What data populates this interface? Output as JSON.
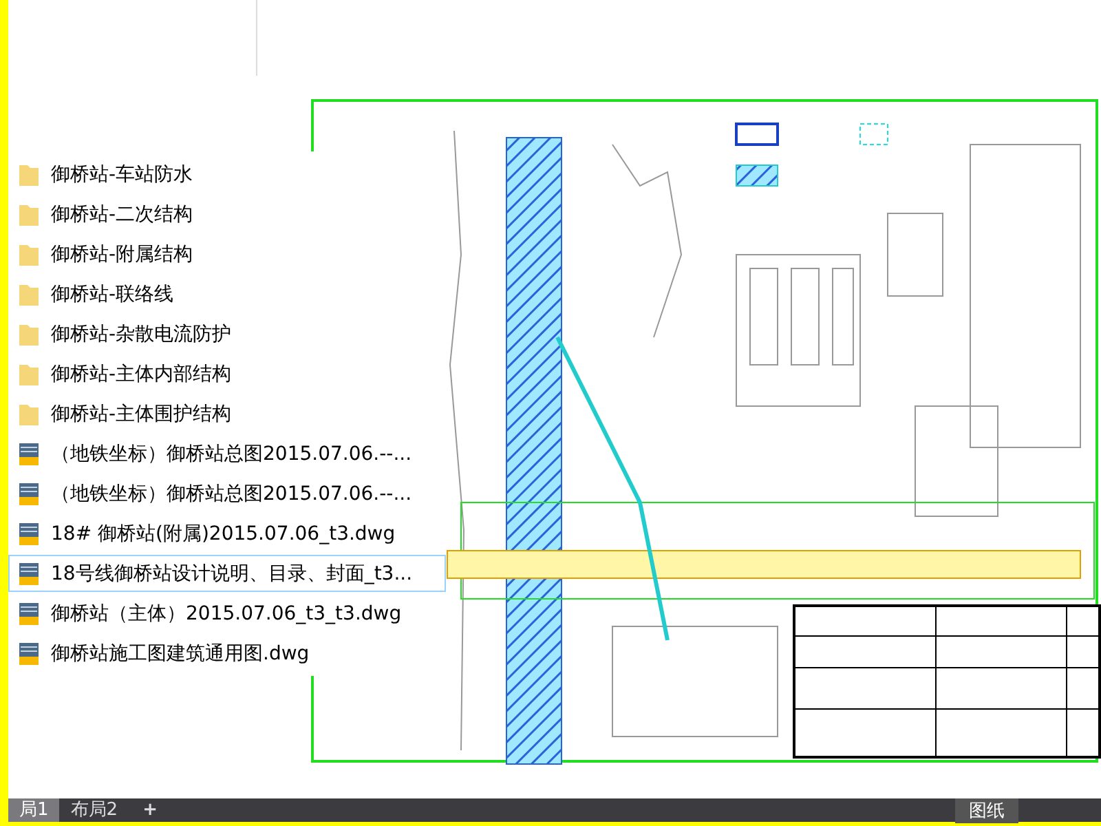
{
  "files": [
    {
      "kind": "folder",
      "name": "御桥站-车站防水",
      "selected": false
    },
    {
      "kind": "folder",
      "name": "御桥站-二次结构",
      "selected": false
    },
    {
      "kind": "folder",
      "name": "御桥站-附属结构",
      "selected": false
    },
    {
      "kind": "folder",
      "name": "御桥站-联络线",
      "selected": false
    },
    {
      "kind": "folder",
      "name": "御桥站-杂散电流防护",
      "selected": false
    },
    {
      "kind": "folder",
      "name": "御桥站-主体内部结构",
      "selected": false
    },
    {
      "kind": "folder",
      "name": "御桥站-主体围护结构",
      "selected": false
    },
    {
      "kind": "dwg",
      "name": "（地铁坐标）御桥站总图2015.07.06.--...",
      "selected": false
    },
    {
      "kind": "dwg",
      "name": "（地铁坐标）御桥站总图2015.07.06.--...",
      "selected": false
    },
    {
      "kind": "dwg",
      "name": "18# 御桥站(附属)2015.07.06_t3.dwg",
      "selected": false
    },
    {
      "kind": "dwg",
      "name": "18号线御桥站设计说明、目录、封面_t3...",
      "selected": true
    },
    {
      "kind": "dwg",
      "name": "御桥站（主体）2015.07.06_t3_t3.dwg",
      "selected": false
    },
    {
      "kind": "dwg",
      "name": "御桥站施工图建筑通用图.dwg",
      "selected": false
    }
  ],
  "layout_tabs": [
    {
      "label": "局1",
      "selected": true
    },
    {
      "label": "布局2",
      "selected": false
    }
  ],
  "add_tab": "+",
  "paper_label": "图纸"
}
